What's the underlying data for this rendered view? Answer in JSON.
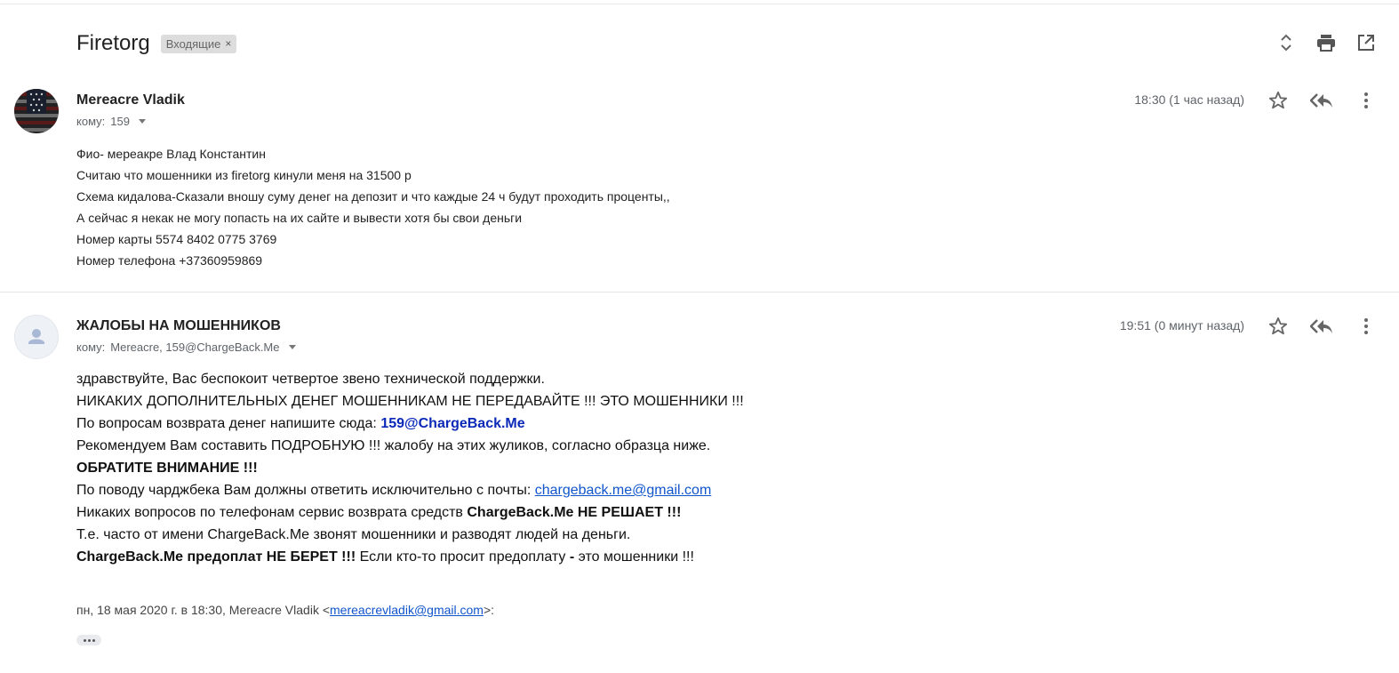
{
  "thread": {
    "subject": "Firetorg",
    "label": "Входящие",
    "label_remove": "×"
  },
  "toolbar_icons": [
    "expand-collapse-icon",
    "print-icon",
    "open-in-new-window-icon"
  ],
  "message1": {
    "sender": "Mereacre Vladik",
    "to_prefix": "кому:",
    "to": "159",
    "time": "18:30 (1 час назад)",
    "body_lines": [
      "Фио- мереакре Влад  Константин",
      "Считаю что мошенники из firetorg кинули меня на 31500 р",
      "Схема кидалова-Сказали вношу суму денег на депозит и что каждые 24 ч будут проходить проценты,,",
      "А сейчас я некак не могу попасть на их сайте и вывести хотя бы свои деньги",
      "Номер карты 5574 8402 0775 3769",
      "Номер телефона +37360959869"
    ]
  },
  "message2": {
    "sender": "ЖАЛОБЫ НА МОШЕННИКОВ",
    "to_prefix": "кому:",
    "to": "Mereacre, 159@ChargeBack.Me",
    "time": "19:51 (0 минут назад)",
    "line1": "здравствуйте, Вас беспокоит четвертое звено технической поддержки.",
    "line2": "НИКАКИХ ДОПОЛНИТЕЛЬНЫХ ДЕНЕГ МОШЕННИКАМ НЕ ПЕРЕДАВАЙТЕ !!! ЭТО МОШЕННИКИ !!!",
    "line3_text": "По вопросам возврата денег напишите сюда: ",
    "line3_link": "159@ChargeBack.Me",
    "line4": "Рекомендуем Вам составить ПОДРОБНУЮ !!! жалобу на этих жуликов, согласно образца ниже.",
    "line5": "ОБРАТИТЕ ВНИМАНИЕ !!!",
    "line6_text": "По поводу чарджбека Вам должны ответить исключительно с почты: ",
    "line6_link": "chargeback.me@gmail.com",
    "line7_text": "Никаких вопросов по телефонам сервис возврата средств ",
    "line7_bold": "ChargeBack.Me НЕ РЕШАЕТ !!!",
    "line8": "Т.е. часто от имени ChargeBack.Me звонят мошенники и разводят людей на деньги.",
    "line9_bold": "ChargeBack.Me предоплат НЕ БЕРЕТ !!!",
    "line9_text": " Если кто-то просит предоплату ",
    "line9_dash": "-",
    "line9_end": " это мошенники !!!",
    "quote_prefix": "пн, 18 мая 2020 г. в 18:30, Mereacre Vladik <",
    "quote_email": "mereacrevladik@gmail.com",
    "quote_suffix": ">:"
  },
  "colors": {
    "link": "#1155cc",
    "blue_bold": "#0b29b8",
    "muted": "#5f6368",
    "chip_bg": "#dddddd"
  }
}
